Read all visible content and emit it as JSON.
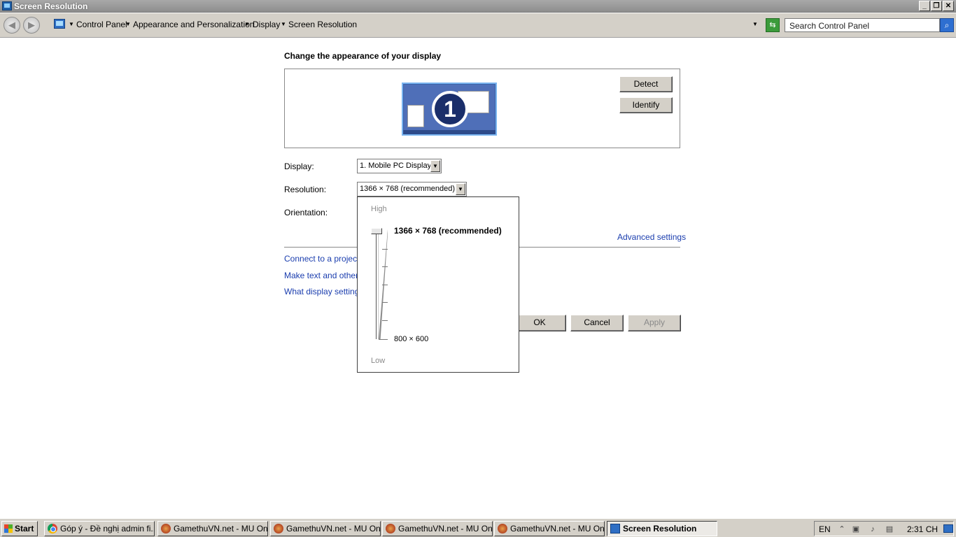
{
  "window": {
    "title": "Screen Resolution"
  },
  "addressbar": {
    "breadcrumbs": [
      "Control Panel",
      "Appearance and Personalization",
      "Display",
      "Screen Resolution"
    ],
    "search_placeholder": "Search Control Panel"
  },
  "main": {
    "heading": "Change the appearance of your display",
    "monitor_number": "1",
    "detect_label": "Detect",
    "identify_label": "Identify",
    "display_label": "Display:",
    "display_value": "1. Mobile PC Display",
    "resolution_label": "Resolution:",
    "resolution_value": "1366 × 768 (recommended)",
    "orientation_label": "Orientation:",
    "advanced_link": "Advanced settings",
    "links": [
      "Connect to a projecto",
      "Make text and other i",
      "What display settings"
    ],
    "ok_label": "OK",
    "cancel_label": "Cancel",
    "apply_label": "Apply"
  },
  "resolution_popup": {
    "high_label": "High",
    "low_label": "Low",
    "max_resolution": "1366 × 768 (recommended)",
    "min_resolution": "800 × 600",
    "slider_level": 1.0
  },
  "taskbar": {
    "start_label": "Start",
    "tasks": [
      {
        "label": "Góp ý - Đề nghị admin fi...",
        "icon": "chrome-icon"
      },
      {
        "label": "GamethuVN.net - MU Onl...",
        "icon": "game-icon"
      },
      {
        "label": "GamethuVN.net - MU Onl...",
        "icon": "game-icon"
      },
      {
        "label": "GamethuVN.net - MU Onl...",
        "icon": "game-icon"
      },
      {
        "label": "GamethuVN.net - MU Onl...",
        "icon": "game-icon"
      },
      {
        "label": "Screen Resolution",
        "icon": "screen-resolution-icon"
      }
    ],
    "language": "EN",
    "clock": "2:31 CH"
  }
}
